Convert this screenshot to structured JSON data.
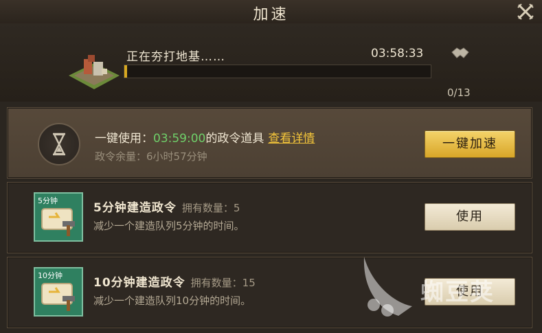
{
  "window": {
    "title": "加速"
  },
  "build": {
    "label": "正在夯打地基……",
    "timer": "03:58:33",
    "progress": 0.01,
    "help_count": "0/13"
  },
  "accelerate": {
    "prefix": "一键使用：",
    "time": "03:59:00",
    "suffix": "的政令道具",
    "details_link": "查看详情",
    "remaining": "政令余量：6小时57分钟",
    "button_label": "一键加速"
  },
  "items": [
    {
      "badge": "5分钟",
      "title": "5分钟建造政令",
      "owned": "拥有数量：5",
      "desc": "减少一个建造队列5分钟的时间。",
      "button_label": "使用"
    },
    {
      "badge": "10分钟",
      "title": "10分钟建造政令",
      "owned": "拥有数量：15",
      "desc": "减少一个建造队列10分钟的时间。",
      "button_label": "使用"
    }
  ],
  "watermark": {
    "text": "蜘豆荚"
  },
  "colors": {
    "accent_gold": "#f3c53a",
    "time_green": "#6fd06a",
    "progress_fill": "#d8a820"
  },
  "icons": [
    "close-icon",
    "building-icon",
    "handshake-icon",
    "hourglass-icon",
    "scroll-hammer-icon"
  ]
}
